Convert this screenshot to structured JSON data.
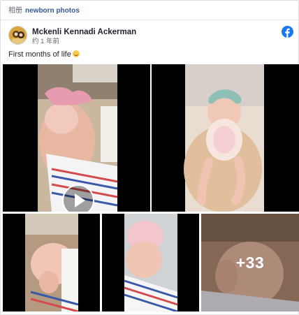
{
  "breadcrumb": {
    "album": "相册",
    "name": "newborn photos"
  },
  "post": {
    "author": "Mckenli Kennadi Ackerman",
    "time": "约 1 年前",
    "caption": "First months of life"
  },
  "photos": {
    "overflow_label": "+33",
    "video_icon": "play-icon"
  },
  "colors": {
    "link": "#385898",
    "facebook": "#1877f2",
    "border": "#dddfe2"
  }
}
